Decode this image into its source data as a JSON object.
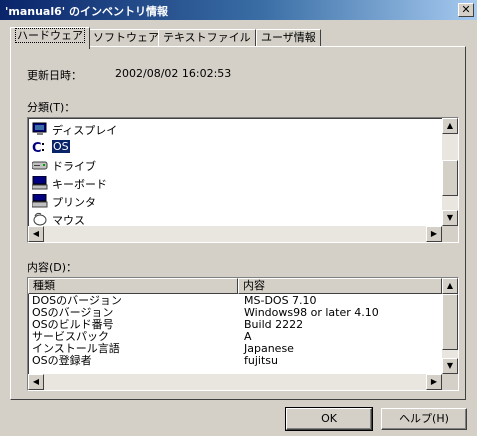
{
  "window": {
    "title": "'manual6' のインベントリ情報",
    "close_label": "✕"
  },
  "tabs": [
    {
      "label": "ハードウェア",
      "active": true
    },
    {
      "label": "ソフトウェア",
      "active": false
    },
    {
      "label": "テキストファイル",
      "active": false
    },
    {
      "label": "ユーザ情報",
      "active": false
    }
  ],
  "hardware": {
    "updated_label": "更新日時：",
    "updated_value": "2002/08/02 16:02:53",
    "category_label": "分類(T)：",
    "categories": [
      {
        "icon": "monitor-icon",
        "label": "ディスプレイ",
        "selected": false
      },
      {
        "icon": "os-icon",
        "label": "OS",
        "selected": true
      },
      {
        "icon": "drive-icon",
        "label": "ドライブ",
        "selected": false
      },
      {
        "icon": "keyboard-icon",
        "label": "キーボード",
        "selected": false
      },
      {
        "icon": "printer-icon",
        "label": "プリンタ",
        "selected": false
      },
      {
        "icon": "mouse-icon",
        "label": "マウス",
        "selected": false
      }
    ],
    "content_label": "内容(D)：",
    "columns": [
      "種類",
      "内容"
    ],
    "rows": [
      [
        "DOSのバージョン",
        "MS-DOS 7.10"
      ],
      [
        "OSのバージョン",
        "Windows98 or later 4.10"
      ],
      [
        "OSのビルド番号",
        "Build 2222"
      ],
      [
        "サービスパック",
        "A"
      ],
      [
        "インストール言語",
        "Japanese"
      ],
      [
        "OSの登録者",
        "fujitsu"
      ]
    ]
  },
  "scroll": {
    "up": "▲",
    "down": "▼",
    "left": "◀",
    "right": "▶"
  },
  "buttons": {
    "ok": "OK",
    "help": "ヘルプ(H)"
  }
}
